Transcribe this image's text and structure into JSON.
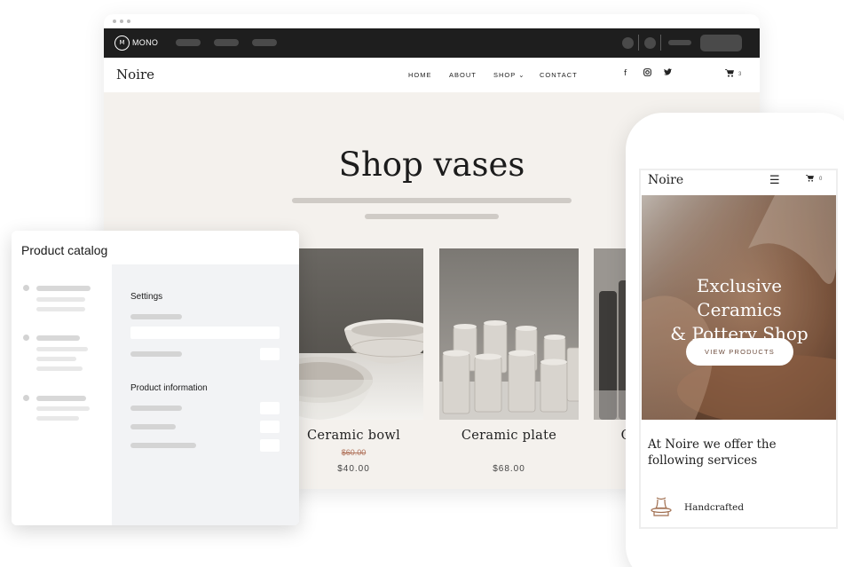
{
  "editor": {
    "logo_mark": "M",
    "logo_text": "MONO"
  },
  "site": {
    "logo": "Noire",
    "nav": [
      "HOME",
      "ABOUT",
      "SHOP ⌄",
      "CONTACT"
    ],
    "social_icons": [
      "facebook-icon",
      "instagram-icon",
      "twitter-icon"
    ],
    "cart_count": "3"
  },
  "shop": {
    "title": "Shop vases",
    "products": [
      {
        "name": "Ceramic bowl",
        "old_price": "$60.00",
        "price": "$40.00"
      },
      {
        "name": "Ceramic plate",
        "old_price": "",
        "price": "$68.00"
      },
      {
        "name": "C",
        "old_price": "",
        "price": ""
      }
    ]
  },
  "catalog": {
    "title": "Product catalog",
    "sections": [
      "Settings",
      "Product information"
    ]
  },
  "mobile": {
    "logo": "Noire",
    "cart_count": "0",
    "hero_title_lines": [
      "Exclusive",
      "Ceramics",
      "& Pottery Shop"
    ],
    "hero_button": "VIEW PRODUCTS",
    "services_text": "At Noire we offer the following services",
    "feature_label": "Handcrafted"
  },
  "colors": {
    "hero_bg": "#f4f1ed",
    "editor_bar": "#1e1e1e",
    "old_price": "#b0725a",
    "catalog_main": "#f2f3f5"
  }
}
